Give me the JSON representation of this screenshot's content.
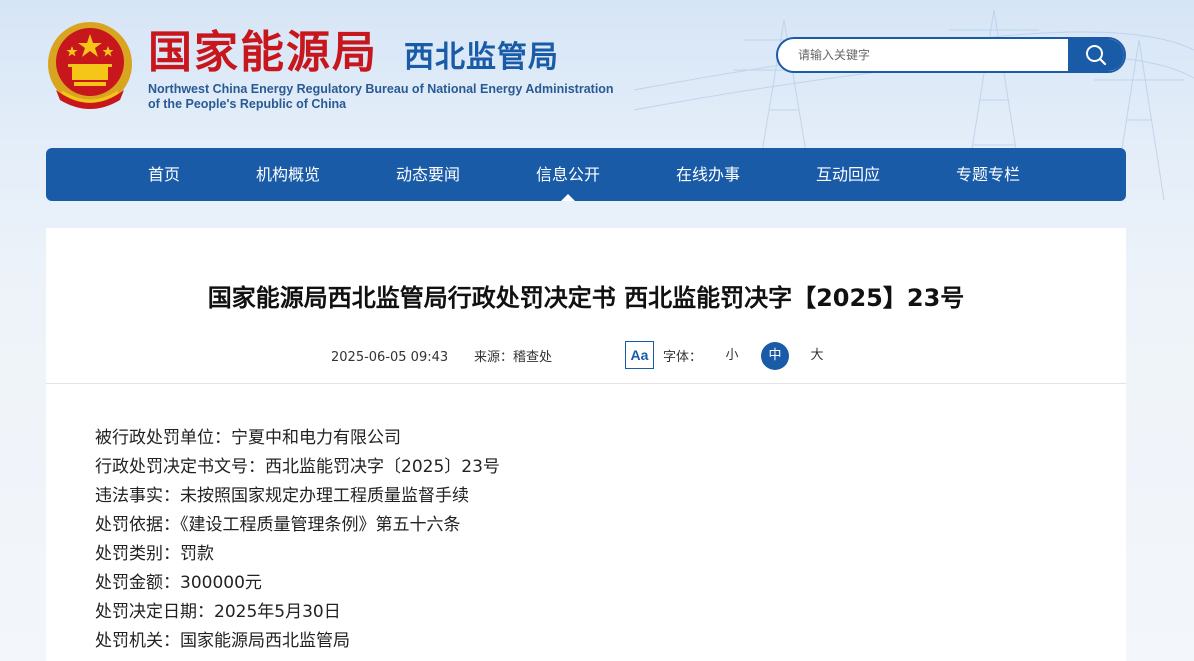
{
  "header": {
    "brand_cn": "国家能源局",
    "brand_sub": "西北监管局",
    "brand_en_line1": "Northwest China Energy Regulatory Bureau of National Energy Administration",
    "brand_en_line2": "of the People's Republic of China"
  },
  "search": {
    "placeholder": "请输入关键字",
    "icon": "search-icon"
  },
  "nav": {
    "items": [
      "首页",
      "机构概览",
      "动态要闻",
      "信息公开",
      "在线办事",
      "互动回应",
      "专题专栏"
    ],
    "active_index": 3
  },
  "article": {
    "title": "国家能源局西北监管局行政处罚决定书 西北监能罚决字【2025】23号",
    "date": "2025-06-05 09:43",
    "source": "来源：稽查处",
    "font_icon": "Aa",
    "font_label": "字体：",
    "font_sizes": [
      "小",
      "中",
      "大"
    ],
    "font_size_active": 1,
    "lines": [
      "被行政处罚单位：宁夏中和电力有限公司",
      "行政处罚决定书文号：西北监能罚决字〔2025〕23号",
      "违法事实：未按照国家规定办理工程质量监督手续",
      "处罚依据：《建设工程质量管理条例》第五十六条",
      "处罚类别：罚款",
      "处罚金额：300000元",
      "处罚决定日期：2025年5月30日",
      "处罚机关：国家能源局西北监管局"
    ]
  },
  "colors": {
    "primary": "#1a5ba8",
    "brand_red": "#c8161d"
  }
}
